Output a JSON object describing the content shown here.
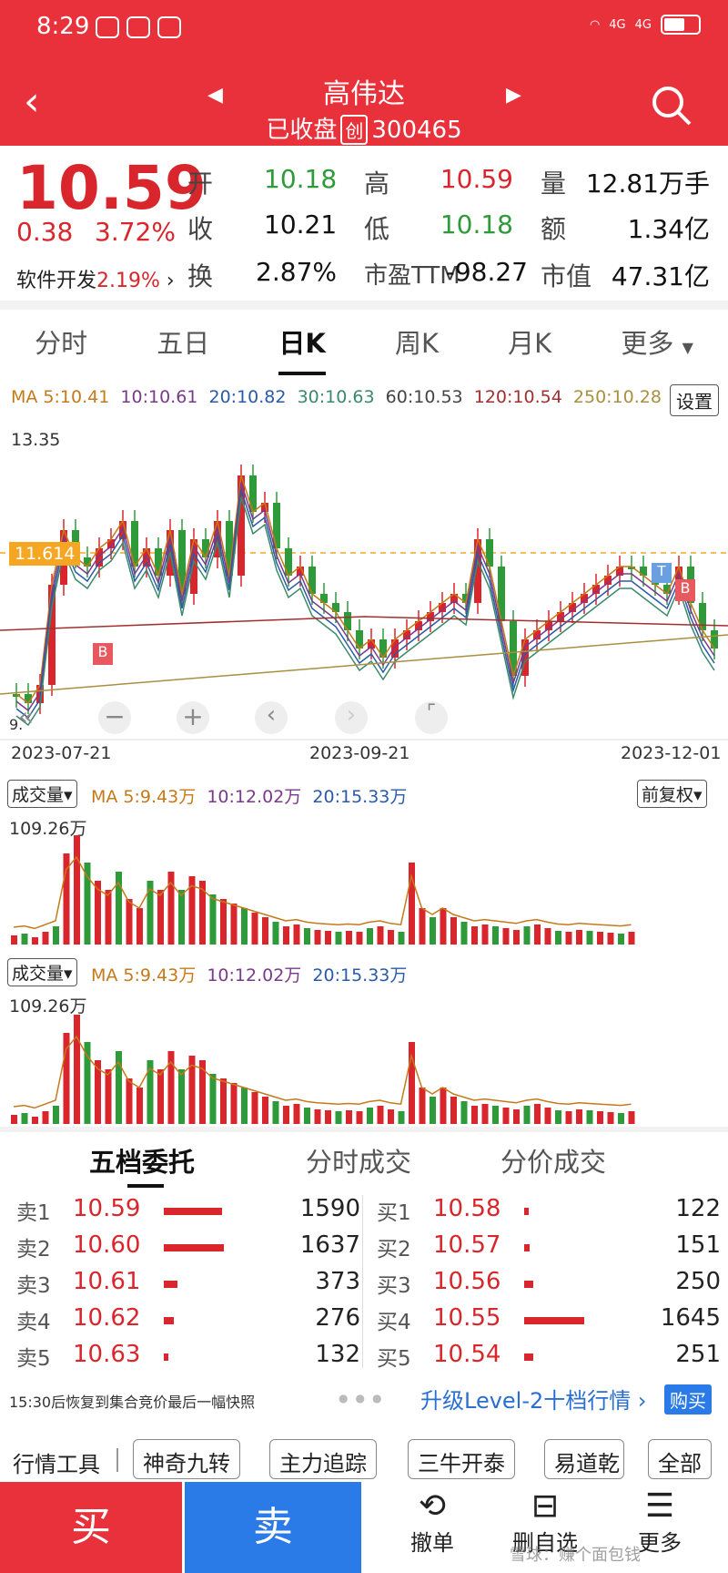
{
  "status": {
    "time": "8:29",
    "net1": "4G",
    "net2": "4G"
  },
  "header": {
    "title": "高伟达",
    "status_text": "已收盘",
    "badge": "创",
    "code": "300465"
  },
  "quote": {
    "price": "10.59",
    "change": "0.38",
    "change_pct": "3.72%",
    "sector": "软件开发",
    "sector_pct": "2.19%",
    "rows": [
      {
        "l1": "开",
        "v1": "10.18",
        "l2": "高",
        "v2": "10.59",
        "l3": "量",
        "v3": "12.81万手"
      },
      {
        "l1": "收",
        "v1": "10.21",
        "l2": "低",
        "v2": "10.18",
        "l3": "额",
        "v3": "1.34亿"
      },
      {
        "l1": "换",
        "v1": "2.87%",
        "l2": "市盈TTM",
        "v2": "-98.27",
        "l3": "市值",
        "v3": "47.31亿"
      }
    ]
  },
  "tabs": [
    "分时",
    "五日",
    "日K",
    "周K",
    "月K",
    "更多"
  ],
  "ma": {
    "ma5": "MA 5:10.41",
    "ma10": "10:10.61",
    "ma20": "20:10.82",
    "ma30": "30:10.63",
    "ma60": "60:10.53",
    "ma120": "120:10.54",
    "ma250": "250:10.28",
    "settings": "设置"
  },
  "kchart": {
    "max": "13.35",
    "ref": "11.614",
    "left_tick": "9.",
    "dates": [
      "2023-07-21",
      "2023-09-21",
      "2023-12-01"
    ]
  },
  "vol1": {
    "label": "成交量",
    "ma5": "MA 5:9.43万",
    "ma10": "10:12.02万",
    "ma20": "20:15.33万",
    "max": "109.26万",
    "adj": "前复权"
  },
  "vol2": {
    "label": "成交量",
    "ma5": "MA 5:9.43万",
    "ma10": "10:12.02万",
    "ma20": "20:15.33万",
    "max": "109.26万"
  },
  "ob_tabs": [
    "五档委托",
    "分时成交",
    "分价成交"
  ],
  "asks": [
    {
      "label": "卖1",
      "price": "10.59",
      "vol": "1590",
      "frac": 0.97
    },
    {
      "label": "卖2",
      "price": "10.60",
      "vol": "1637",
      "frac": 1.0
    },
    {
      "label": "卖3",
      "price": "10.61",
      "vol": "373",
      "frac": 0.23
    },
    {
      "label": "卖4",
      "price": "10.62",
      "vol": "276",
      "frac": 0.17
    },
    {
      "label": "卖5",
      "price": "10.63",
      "vol": "132",
      "frac": 0.08
    }
  ],
  "bids": [
    {
      "label": "买1",
      "price": "10.58",
      "vol": "122",
      "frac": 0.07
    },
    {
      "label": "买2",
      "price": "10.57",
      "vol": "151",
      "frac": 0.09
    },
    {
      "label": "买3",
      "price": "10.56",
      "vol": "250",
      "frac": 0.15
    },
    {
      "label": "买4",
      "price": "10.55",
      "vol": "1645",
      "frac": 1.0
    },
    {
      "label": "买5",
      "price": "10.54",
      "vol": "251",
      "frac": 0.15
    }
  ],
  "notice": "15:30后恢复到集合竞价最后一幅快照",
  "upgrade": "升级Level-2十档行情 ›",
  "buy_badge": "购买",
  "tools": {
    "label": "行情工具",
    "items": [
      "神奇九转",
      "主力追踪",
      "三牛开泰",
      "易道乾"
    ],
    "all": "全部"
  },
  "actions": {
    "buy": "买",
    "sell": "卖",
    "cancel": "撤单",
    "watch": "删自选",
    "more": "更多",
    "watermark": "雪球：赚个面包钱"
  }
}
